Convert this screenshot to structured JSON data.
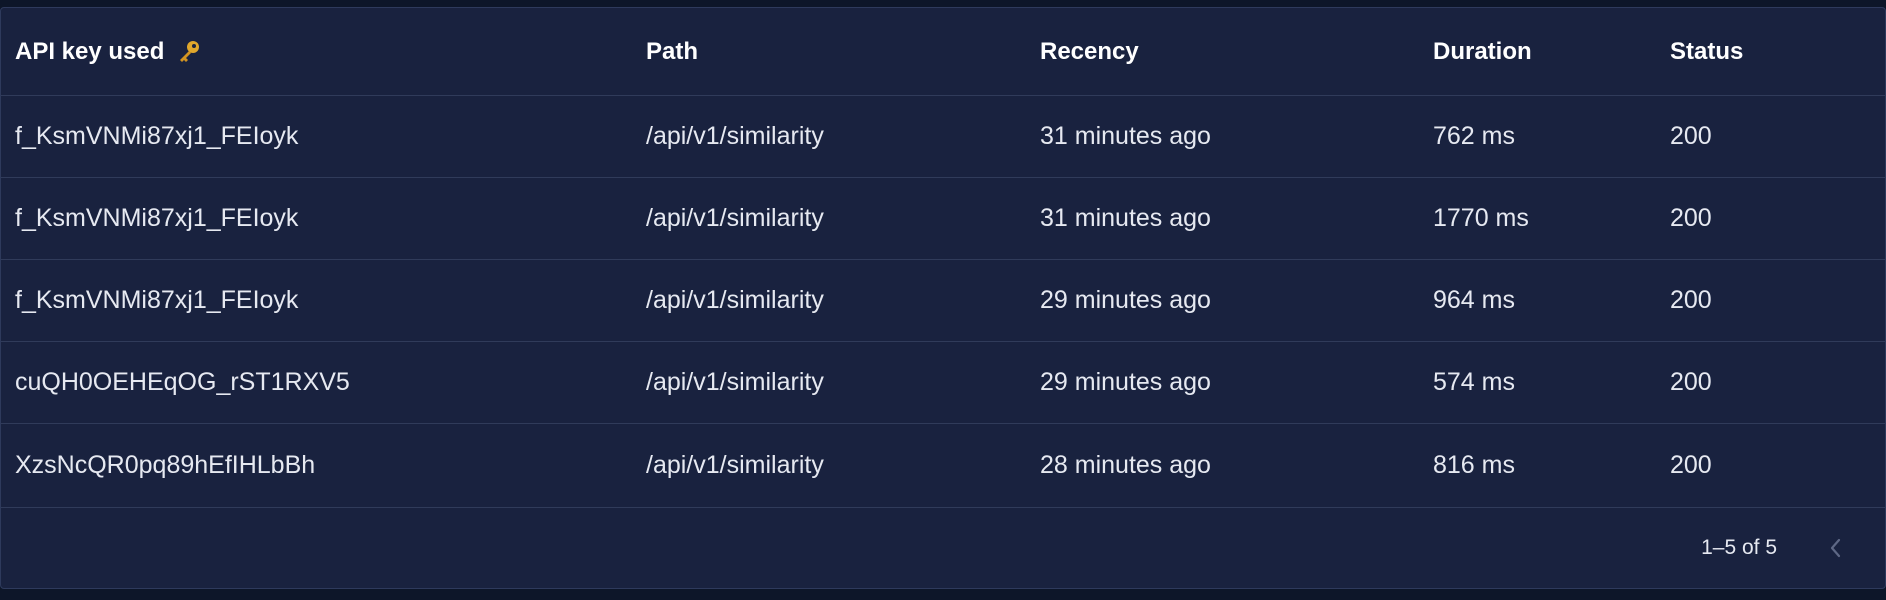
{
  "table": {
    "headers": {
      "api_key": "API key used",
      "path": "Path",
      "recency": "Recency",
      "duration": "Duration",
      "status": "Status"
    },
    "rows": [
      {
        "api_key": "f_KsmVNMi87xj1_FEIoyk",
        "path": "/api/v1/similarity",
        "recency": "31 minutes ago",
        "duration": "762 ms",
        "status": "200"
      },
      {
        "api_key": "f_KsmVNMi87xj1_FEIoyk",
        "path": "/api/v1/similarity",
        "recency": "31 minutes ago",
        "duration": "1770 ms",
        "status": "200"
      },
      {
        "api_key": "f_KsmVNMi87xj1_FEIoyk",
        "path": "/api/v1/similarity",
        "recency": "29 minutes ago",
        "duration": "964 ms",
        "status": "200"
      },
      {
        "api_key": "cuQH0OEHEqOG_rST1RXV5",
        "path": "/api/v1/similarity",
        "recency": "29 minutes ago",
        "duration": "574 ms",
        "status": "200"
      },
      {
        "api_key": "XzsNcQR0pq89hEfIHLbBh",
        "path": "/api/v1/similarity",
        "recency": "28 minutes ago",
        "duration": "816 ms",
        "status": "200"
      }
    ]
  },
  "pagination": {
    "range_text": "1–5 of 5",
    "prev_icon": "chevron-left-icon"
  },
  "colors": {
    "background": "#0d1629",
    "panel": "#19223f",
    "divider": "#303b5a",
    "text": "#e6e9f1",
    "key_icon": "#e0a72c",
    "disabled": "#5e6885"
  },
  "icons": {
    "header_key": "key-icon"
  }
}
